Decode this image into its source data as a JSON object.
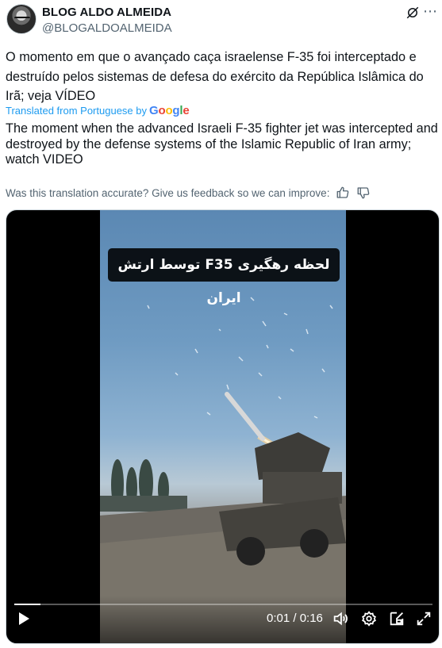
{
  "author": {
    "name": "BLOG ALDO ALMEIDA",
    "handle": "@BLOGALDOALMEIDA"
  },
  "post": {
    "original_text": "O momento em que o avançado caça israelense F-35 foi interceptado e destruído pelos sistemas de defesa do exército da República Islâmica do Irã; veja VÍDEO",
    "translated_by_label": "Translated from Portuguese by",
    "translated_by_brand": "Google",
    "translated_text": "The moment when the advanced Israeli F-35 fighter jet was intercepted and destroyed by the defense systems of the Islamic Republic of Iran army; watch VIDEO",
    "feedback_prompt": "Was this translation accurate? Give us feedback so we can improve:"
  },
  "video": {
    "caption_overlay": "لحظه رهگیری F35 توسط ارتش ایران",
    "current_time": "0:01",
    "duration": "0:16",
    "time_display": "0:01 / 0:16",
    "progress_fraction": 0.0625
  },
  "icons": {
    "grok": "grok-icon",
    "more": "more-icon",
    "thumbs_up": "thumbs-up-icon",
    "thumbs_down": "thumbs-down-icon",
    "play": "play-icon",
    "volume": "volume-icon",
    "settings": "settings-icon",
    "pip": "picture-in-picture-icon",
    "fullscreen": "fullscreen-icon"
  },
  "colors": {
    "link": "#1d9bf0",
    "muted": "#536471",
    "text": "#0f1419"
  }
}
